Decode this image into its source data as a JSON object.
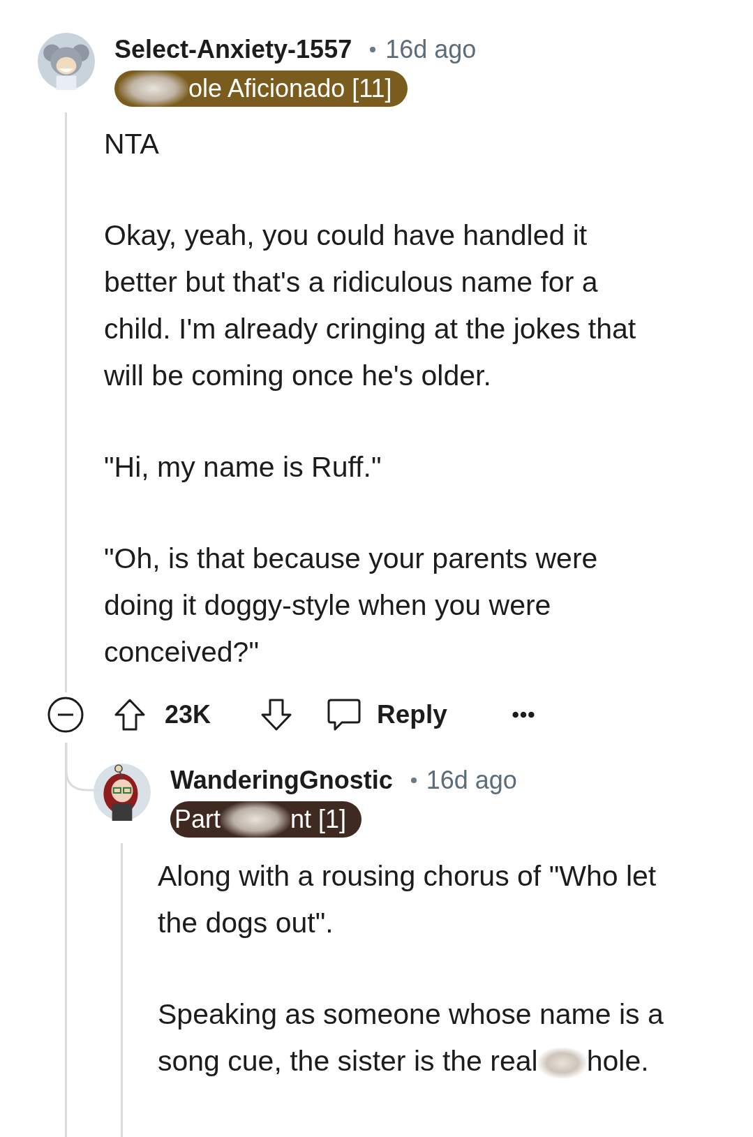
{
  "comment": {
    "author": "Select-Anxiety-1557",
    "time": "16d ago",
    "flair": {
      "color": "#7a5d1e",
      "segments": [
        {
          "kind": "redacted"
        },
        {
          "kind": "text",
          "text": "ole Aficionado [11]"
        }
      ]
    },
    "paragraphs": [
      [
        {
          "kind": "text",
          "text": "NTA"
        }
      ],
      [
        {
          "kind": "text",
          "text": "Okay, yeah, you could have handled it better but that's a ridiculous name for a child. I'm already cringing at the jokes that will be coming once he's older."
        }
      ],
      [
        {
          "kind": "text",
          "text": "\"Hi, my name is Ruff.\""
        }
      ],
      [
        {
          "kind": "text",
          "text": "\"Oh, is that because your parents were doing it doggy-style when you were conceived?\""
        }
      ]
    ],
    "actions": {
      "collapsed": false,
      "votes": "23K",
      "reply": "Reply"
    },
    "replies": [
      {
        "author": "WanderingGnostic",
        "time": "16d ago",
        "flair": {
          "color": "#3f2a22",
          "segments": [
            {
              "kind": "text",
              "text": "Part"
            },
            {
              "kind": "redacted"
            },
            {
              "kind": "text",
              "text": "nt [1]"
            }
          ]
        },
        "paragraphs": [
          [
            {
              "kind": "text",
              "text": "Along with a rousing chorus of \"Who let the dogs out\"."
            }
          ],
          [
            {
              "kind": "text",
              "text": "Speaking as someone whose name is a song cue, the sister is the real"
            },
            {
              "kind": "redacted"
            },
            {
              "kind": "text",
              "text": "hole."
            }
          ]
        ]
      }
    ]
  }
}
